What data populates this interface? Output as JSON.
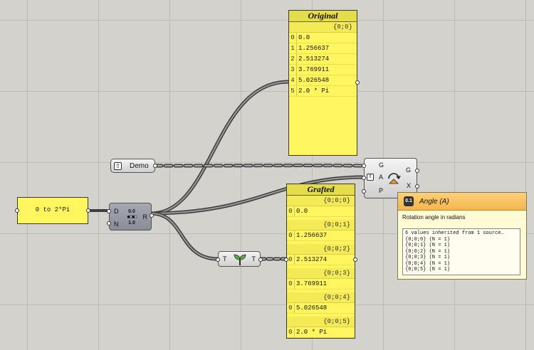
{
  "panels": {
    "original": {
      "title": "Original",
      "path": "{0;0}",
      "rows": [
        {
          "index": "0",
          "value": "0.0"
        },
        {
          "index": "1",
          "value": "1.256637"
        },
        {
          "index": "2",
          "value": "2.513274"
        },
        {
          "index": "3",
          "value": "3.769911"
        },
        {
          "index": "4",
          "value": "5.026548"
        },
        {
          "index": "5",
          "value": "2.0 * Pi"
        }
      ]
    },
    "grafted": {
      "title": "Grafted",
      "branches": [
        {
          "path": "{0;0;0}",
          "index": "0",
          "value": "0.0"
        },
        {
          "path": "{0;0;1}",
          "index": "0",
          "value": "1.256637"
        },
        {
          "path": "{0;0;2}",
          "index": "0",
          "value": "2.513274"
        },
        {
          "path": "{0;0;3}",
          "index": "0",
          "value": "3.769911"
        },
        {
          "path": "{0;0;4}",
          "index": "0",
          "value": "5.026548"
        },
        {
          "path": "{0;0;5}",
          "index": "0",
          "value": "2.0 * Pi"
        }
      ]
    },
    "range_input": {
      "value": "0 to 2*Pi"
    }
  },
  "demo": {
    "label": "Demo"
  },
  "range_node": {
    "in1": "D",
    "in2": "N",
    "out": "R",
    "icon_top": "0.0",
    "icon_bottom": "1.0"
  },
  "graft_node": {
    "in": "T",
    "out": "T"
  },
  "rotate_node": {
    "inputs": [
      "G",
      "A",
      "P"
    ],
    "outputs": [
      "G",
      "X"
    ]
  },
  "tooltip": {
    "badge": "0.1",
    "title": "Angle (A)",
    "description": "Rotation angle in radians",
    "summary": "6 values inherited from 1 source…",
    "lines": [
      "{0;0;0} (N = 1)",
      "{0;0;1} (N = 1)",
      "{0;0;2} (N = 1)",
      "{0;0;3} (N = 1)",
      "{0;0;4} (N = 1)",
      "{0;0;5} (N = 1)"
    ]
  }
}
